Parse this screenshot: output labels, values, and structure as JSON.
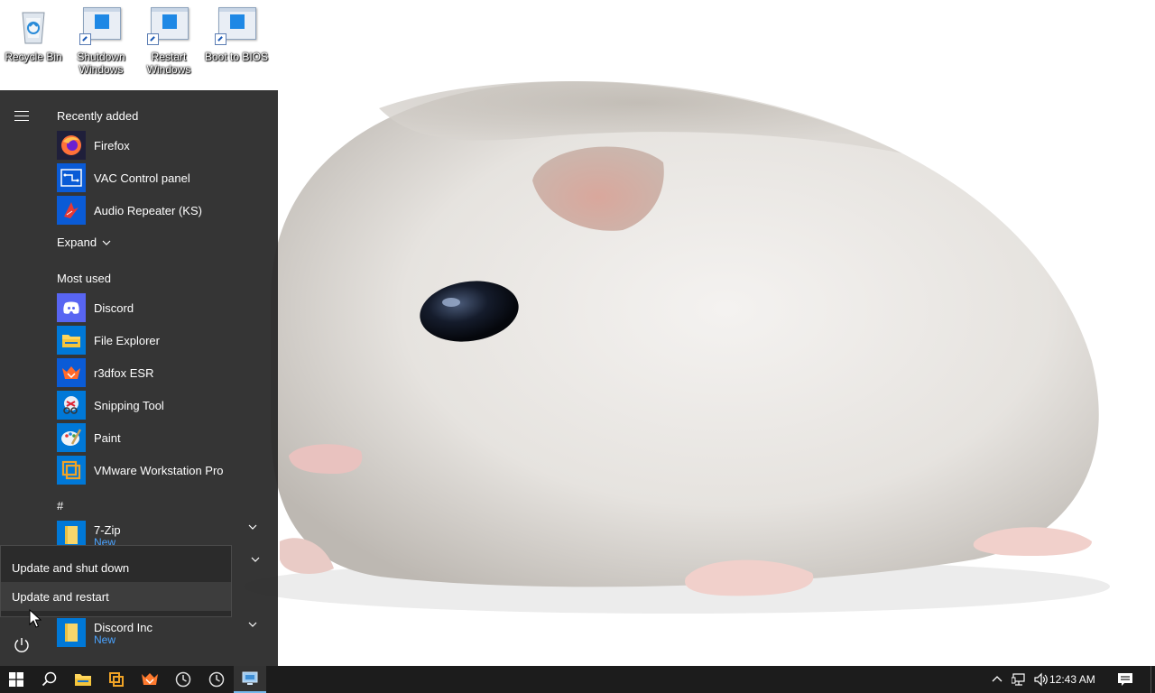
{
  "desktop": {
    "icons": [
      {
        "label": "Recycle Bin",
        "icon": "recycle-bin-icon"
      },
      {
        "label": "Shutdown\nWindows",
        "icon": "shortcut-icon"
      },
      {
        "label": "Restart\nWindows",
        "icon": "shortcut-icon"
      },
      {
        "label": "Boot to BIOS",
        "icon": "shortcut-icon"
      }
    ]
  },
  "start_menu": {
    "recently_added_heading": "Recently added",
    "recently_added": [
      {
        "name": "Firefox",
        "icon": "firefox-icon"
      },
      {
        "name": "VAC Control panel",
        "icon": "vac-control-panel-icon"
      },
      {
        "name": "Audio Repeater (KS)",
        "icon": "audio-repeater-icon"
      }
    ],
    "expand_label": "Expand",
    "most_used_heading": "Most used",
    "most_used": [
      {
        "name": "Discord",
        "icon": "discord-icon"
      },
      {
        "name": "File Explorer",
        "icon": "file-explorer-icon"
      },
      {
        "name": "r3dfox ESR",
        "icon": "r3dfox-icon"
      },
      {
        "name": "Snipping Tool",
        "icon": "snipping-tool-icon"
      },
      {
        "name": "Paint",
        "icon": "paint-icon"
      },
      {
        "name": "VMware Workstation Pro",
        "icon": "vmware-icon"
      }
    ],
    "hash_heading": "#",
    "folders": [
      {
        "name": "7-Zip",
        "badge": "New",
        "icon": "folder-icon"
      },
      {
        "name": "Discord Inc",
        "badge": "New",
        "icon": "folder-icon"
      }
    ]
  },
  "power_flyout": {
    "items": [
      "Update and shut down",
      "Update and restart"
    ]
  },
  "taskbar": {
    "clock": "12:43 AM",
    "apps": [
      "start-icon",
      "search-icon",
      "file-explorer-icon",
      "vmware-icon",
      "firefox-icon",
      "clock-app-icon",
      "clock-app-icon",
      "remote-desktop-icon"
    ]
  },
  "colors": {
    "start_bg": "#262626",
    "accent": "#0078d7",
    "taskbar_bg": "#1c1c1c",
    "new_badge": "#4aa3ff"
  }
}
